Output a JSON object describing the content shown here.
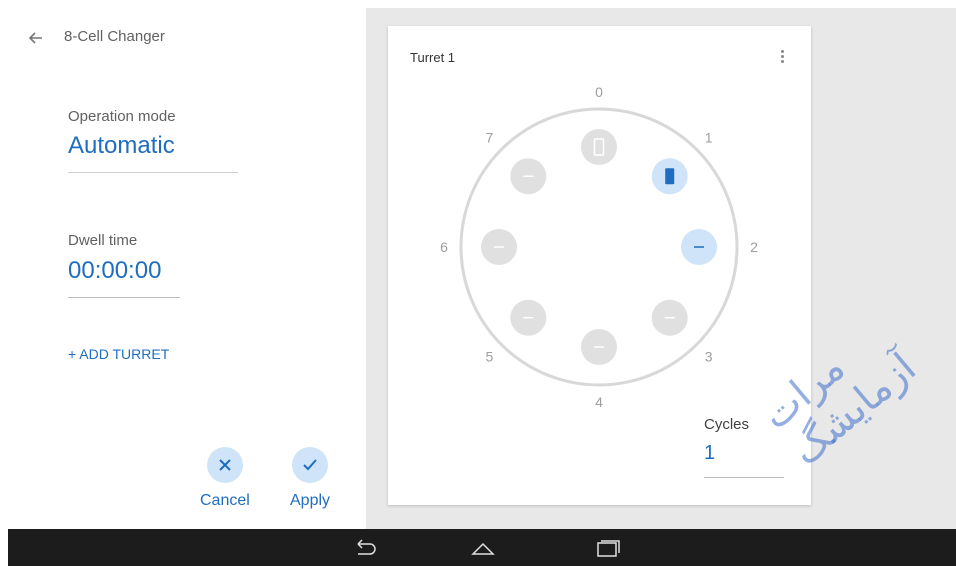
{
  "header": {
    "back_icon": "arrow-left-icon",
    "title": "8-Cell Changer"
  },
  "operation": {
    "label": "Operation mode",
    "value": "Automatic"
  },
  "dwell": {
    "label": "Dwell time",
    "value": "00:00:00"
  },
  "add_turret": {
    "label": "+ ADD TURRET"
  },
  "actions": {
    "cancel": {
      "label": "Cancel",
      "icon": "close-icon"
    },
    "apply": {
      "label": "Apply",
      "icon": "check-icon"
    }
  },
  "turret": {
    "title": "Turret 1",
    "menu_icon": "more-vert-icon",
    "positions": [
      {
        "number": "0",
        "state": "cell-empty-outline"
      },
      {
        "number": "1",
        "state": "cell-active"
      },
      {
        "number": "2",
        "state": "empty-selected"
      },
      {
        "number": "3",
        "state": "empty"
      },
      {
        "number": "4",
        "state": "empty"
      },
      {
        "number": "5",
        "state": "empty"
      },
      {
        "number": "6",
        "state": "empty"
      },
      {
        "number": "7",
        "state": "empty"
      }
    ]
  },
  "cycles": {
    "label": "Cycles",
    "value": "1"
  },
  "navbar": {
    "back_icon": "nav-back-icon",
    "home_icon": "nav-home-icon",
    "recents_icon": "nav-recents-icon"
  },
  "colors": {
    "accent": "#1f6dc0",
    "accent_light": "#cfe4f8",
    "muted": "#e0e0e0",
    "navbar": "#1c1c1c"
  },
  "watermark": {
    "text": "مرات آزمایشگ"
  }
}
